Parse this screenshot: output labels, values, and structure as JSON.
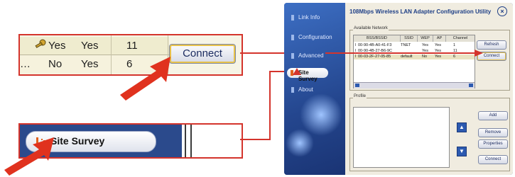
{
  "zoom_network": {
    "row1": {
      "bssid": "…",
      "wep": "Yes",
      "ap": "Yes",
      "channel": "11"
    },
    "row2": {
      "bssid": "…",
      "wep": "No",
      "ap": "Yes",
      "channel": "6"
    },
    "connect_label": "Connect"
  },
  "zoom_site_survey": {
    "label": "Site Survey"
  },
  "app": {
    "title": "108Mbps Wireless LAN Adapter Configuration Utility",
    "nav": [
      "Link Info",
      "Configuration",
      "Advanced",
      "Site Survey",
      "About"
    ],
    "available_network": {
      "label": "Available Network",
      "columns": [
        "BSS/BSSID",
        "SSID",
        "WEP",
        "AP",
        "Channel"
      ],
      "rows": [
        {
          "bssid": "00-90-4B-A0-41-F3",
          "ssid": "TNET",
          "wep": "Yes",
          "ap": "Yes",
          "channel": "1"
        },
        {
          "bssid": "00-90-4B-27-B6-9C",
          "ssid": "",
          "wep": "Yes",
          "ap": "Yes",
          "channel": "11"
        },
        {
          "bssid": "00-03-2F-27-05-85",
          "ssid": "default",
          "wep": "No",
          "ap": "Yes",
          "channel": "6"
        }
      ],
      "refresh_label": "Refresh",
      "connect_label": "Connect"
    },
    "profile": {
      "label": "Profile",
      "add_label": "Add",
      "remove_label": "Remove",
      "properties_label": "Properties",
      "connect_label": "Connect"
    }
  },
  "colors": {
    "callout": "#d4342c",
    "arrow": "#e0321e",
    "app_blue": "#2f58a6"
  }
}
